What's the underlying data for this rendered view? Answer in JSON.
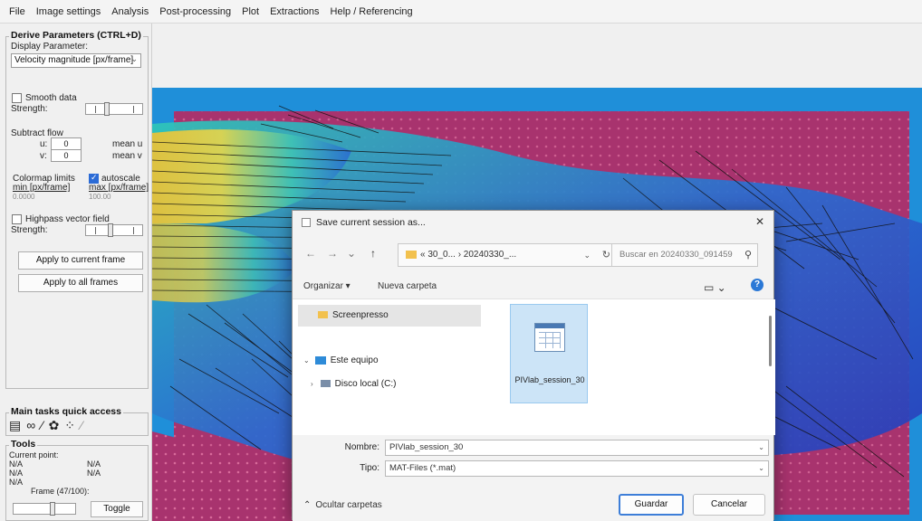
{
  "menu": [
    "File",
    "Image settings",
    "Analysis",
    "Post-processing",
    "Plot",
    "Extractions",
    "Help / Referencing"
  ],
  "derive": {
    "title": "Derive Parameters (CTRL+D)",
    "display_label": "Display Parameter:",
    "display_value": "Velocity magnitude [px/frame]",
    "smooth_label": "Smooth data",
    "strength_label": "Strength:",
    "subtract_label": "Subtract flow",
    "u_label": "u:",
    "v_label": "v:",
    "u_value": "0",
    "v_value": "0",
    "mean_u": "mean u",
    "mean_v": "mean v",
    "colormap_label": "Colormap limits",
    "autoscale_label": "autoscale",
    "min_label": "min [px/frame]",
    "max_label": "max [px/frame]",
    "min_value": "0.0000",
    "max_value": "100.00",
    "highpass_label": "Highpass vector field",
    "strength2_label": "Strength:",
    "apply_current": "Apply to current frame",
    "apply_all": "Apply to all frames"
  },
  "quick": {
    "title": "Main tasks quick access"
  },
  "tools": {
    "title": "Tools",
    "current_point": "Current point:",
    "na1": "N/A",
    "na2": "N/A",
    "na3": "N/A",
    "na4": "N/A",
    "na5": "N/A",
    "frame_label": "Frame (47/100):",
    "toggle": "Toggle"
  },
  "dialog": {
    "title": "Save current session as...",
    "address": "« 30_0... › 20240330_...",
    "search_placeholder": "Buscar en 20240330_091459",
    "organize": "Organizar ▾",
    "new_folder": "Nueva carpeta",
    "nav_items": [
      "Screenpresso",
      "Este equipo",
      "Disco local (C:)"
    ],
    "file_name": "PIVlab_session_30",
    "name_label": "Nombre:",
    "name_value": "PIVlab_session_30",
    "type_label": "Tipo:",
    "type_value": "MAT-Files (*.mat)",
    "hide_folders": "Ocultar carpetas",
    "save": "Guardar",
    "cancel": "Cancelar"
  },
  "colors": {
    "plot_bg": "#1f8fd9",
    "mask": "#b03a78",
    "accent": "#2b6bd6"
  }
}
